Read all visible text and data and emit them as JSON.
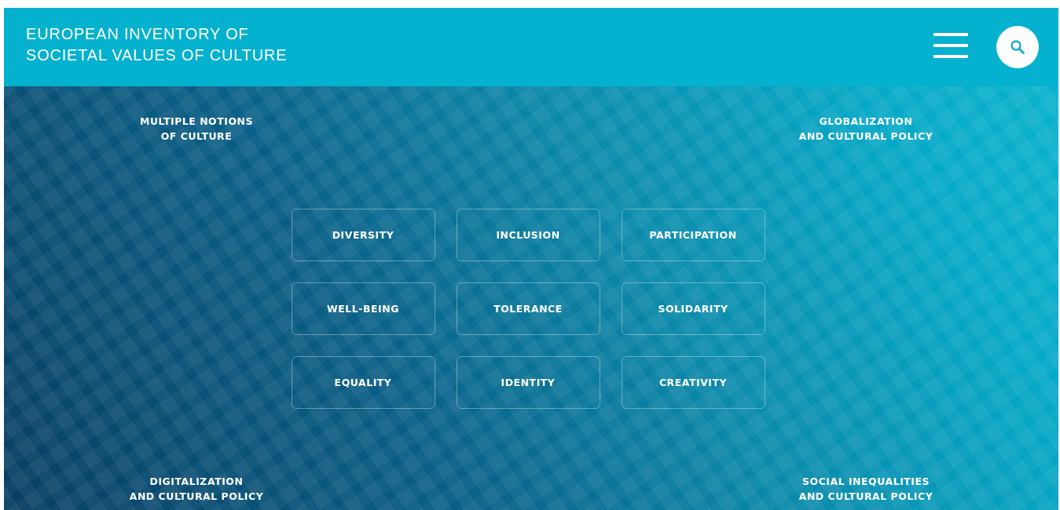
{
  "header": {
    "title_lines": [
      "EUROPEAN INVENTORY OF",
      "SOCIETAL VALUES OF CULTURE"
    ]
  },
  "topics": [
    "MULTIPLE NOTIONS\nOF CULTURE",
    "GLOBALIZATION\nAND CULTURAL POLICY",
    "DIGITALIZATION\nAND CULTURAL POLICY",
    "SOCIAL INEQUALITIES\nAND CULTURAL POLICY"
  ],
  "values": [
    "DIVERSITY",
    "INCLUSION",
    "PARTICIPATION",
    "WELL-BEING",
    "TOLERANCE",
    "SOLIDARITY",
    "EQUALITY",
    "IDENTITY",
    "CREATIVITY"
  ]
}
